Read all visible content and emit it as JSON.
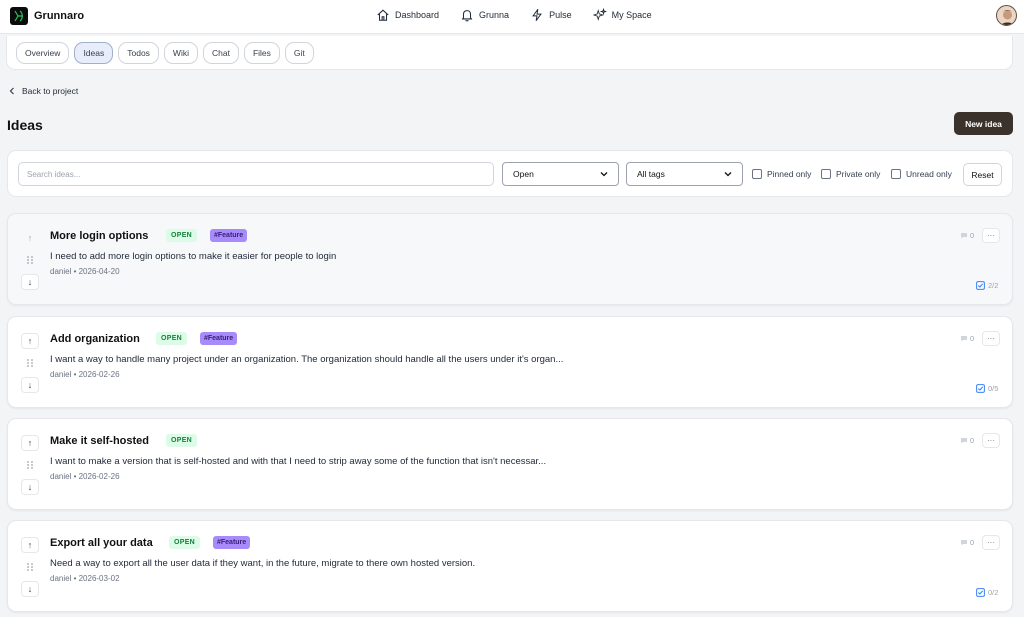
{
  "app": {
    "name": "Grunnaro"
  },
  "nav": [
    {
      "label": "Dashboard",
      "icon": "home-icon"
    },
    {
      "label": "Grunna",
      "icon": "bell-icon"
    },
    {
      "label": "Pulse",
      "icon": "lightning-icon"
    },
    {
      "label": "My Space",
      "icon": "sparkles-icon"
    }
  ],
  "tabs": [
    "Overview",
    "Ideas",
    "Todos",
    "Wiki",
    "Chat",
    "Files",
    "Git"
  ],
  "active_tab": "Ideas",
  "back_label": "Back to project",
  "page_title": "Ideas",
  "new_button": "New idea",
  "filters": {
    "search_placeholder": "Search ideas...",
    "status_value": "Open",
    "tags_value": "All tags",
    "pinned": "Pinned only",
    "private": "Private only",
    "unread": "Unread only",
    "reset": "Reset"
  },
  "ideas": [
    {
      "title": "More login options",
      "status": "OPEN",
      "tag": "#Feature",
      "description": "I need to add more login options to make it easier for people to login",
      "meta": "daniel • 2026-04-20",
      "comments": "0",
      "todos": "2/2"
    },
    {
      "title": "Add organization",
      "status": "OPEN",
      "tag": "#Feature",
      "description": "I want a way to handle many project under an organization. The organization should handle all the users under it's organ...",
      "meta": "daniel • 2026-02-26",
      "comments": "0",
      "todos": "0/5"
    },
    {
      "title": "Make it self-hosted",
      "status": "OPEN",
      "tag": "",
      "description": "I want to make a version that is self-hosted and with that I need to strip away some of the function that isn't necessar...",
      "meta": "daniel • 2026-02-26",
      "comments": "0",
      "todos": ""
    },
    {
      "title": "Export all your data",
      "status": "OPEN",
      "tag": "#Feature",
      "description": "Need a way to export all the user data if they want, in the future, migrate to there own hosted version.",
      "meta": "daniel • 2026-03-02",
      "comments": "0",
      "todos": "0/2"
    }
  ],
  "colors": {
    "primary_button": "#3b332b",
    "status_open_bg": "#dcfce7",
    "status_open_text": "#15803d",
    "tag_bg": "#a78bfa"
  }
}
